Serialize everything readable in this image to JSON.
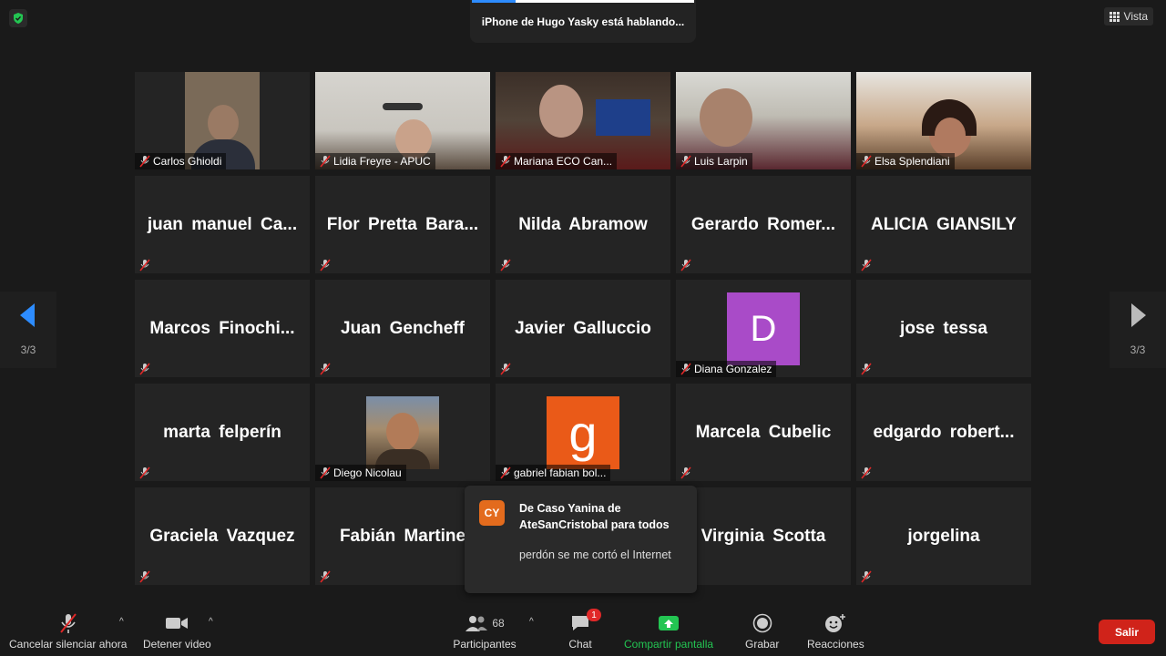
{
  "top": {
    "speaking": "iPhone de Hugo Yasky está hablando...",
    "view_label": "Vista"
  },
  "page_indicator": "3/3",
  "video_tiles": [
    {
      "name": "Carlos Ghioldi"
    },
    {
      "name": "Lidia Freyre - APUC"
    },
    {
      "name": "Mariana ECO Can..."
    },
    {
      "name": "Luis Larpin"
    },
    {
      "name": "Elsa Splendiani"
    }
  ],
  "name_tiles": {
    "r2": [
      "juan  manuel  Ca...",
      "Flor  Pretta  Bara...",
      "Nilda Abramow",
      "Gerardo  Romer...",
      "ALICIA GIANSILY"
    ],
    "r3": [
      "Marcos  Finochi...",
      "Juan Gencheff",
      "Javier Galluccio",
      "jose tessa"
    ],
    "r4": [
      "marta felperín",
      "Marcela Cubelic",
      "edgardo  robert..."
    ],
    "r5": [
      "Graciela Vazquez",
      "Fabián  Martine",
      "Virginia Scotta",
      "jorgelina"
    ]
  },
  "avatar_tiles": {
    "diana": {
      "letter": "D",
      "name": "Diana Gonzalez",
      "color": "#a94bc8"
    },
    "diego": {
      "name": "Diego Nicolau"
    },
    "gabriel": {
      "letter": "g",
      "name": "gabriel fabian bol...",
      "color": "#ea5a18"
    }
  },
  "chat_popup": {
    "initials": "CY",
    "from": "De Caso Yanina de AteSanCristobal para todos",
    "message": "perdón se me cortó el Internet"
  },
  "toolbar": {
    "unmute": "Cancelar silenciar ahora",
    "video": "Detener video",
    "participants": "Participantes",
    "participants_count": "68",
    "chat": "Chat",
    "chat_badge": "1",
    "share": "Compartir pantalla",
    "record": "Grabar",
    "reactions": "Reacciones",
    "leave": "Salir"
  },
  "colors": {
    "share_green": "#23c552",
    "leave_red": "#d0231a",
    "nav_blue": "#2d8cff"
  }
}
